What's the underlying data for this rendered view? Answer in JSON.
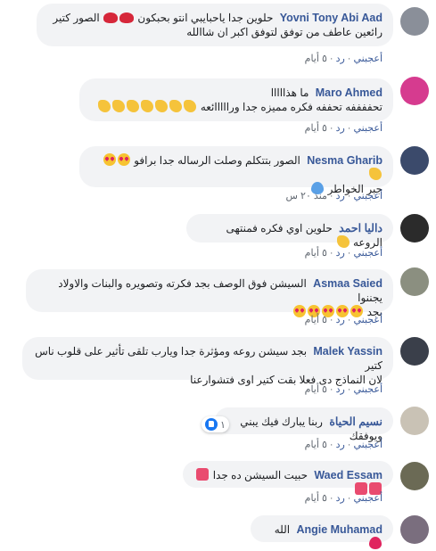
{
  "meta_labels": {
    "like": "أعجبني",
    "reply": "رد"
  },
  "comments": [
    {
      "name": "Yovni Tony Abi Aad",
      "text": "حلوين جدا ياحبايبي انتو بحبكون",
      "text2": "الصور كتير رائعين عاطف من توفق لتوفق اكبر ان شاالله",
      "time": "٥ أيام",
      "emojis": [
        "kiss",
        "kiss"
      ],
      "avatar_color": "#8a8f99"
    },
    {
      "name": "Maro Ahmed",
      "text": "ما هذااااا",
      "text2": "تحففففه تحففه فكره مميزه جدا ورااااائعه",
      "time": "٥ أيام",
      "emojis": [
        "clap",
        "clap",
        "clap",
        "clap",
        "clap",
        "clap",
        "clap",
        "clap",
        "clap"
      ],
      "avatar_color": "#d63b8f"
    },
    {
      "name": "Nesma Gharib",
      "text": "الصور بتتكلم وصلت الرساله جدا برافو",
      "text2": "جبر الخواطر",
      "time": "منذ ٢٠ س",
      "emojis": [
        "hearteyes",
        "hearteyes",
        "clap"
      ],
      "avatar_color": "#3b4a6b"
    },
    {
      "name": "داليا احمد",
      "text": "حلوين اوي فكره فمنتهى الروعه",
      "text2": "",
      "time": "٥ أيام",
      "emojis": [
        "clap"
      ],
      "avatar_color": "#2b2b2b"
    },
    {
      "name": "Asmaa Saied",
      "text": "السيشن فوق الوصف بجد فكرته وتصويره والبنات والاولاد يجننوا",
      "text2": "بجد",
      "time": "٥ أيام",
      "emojis": [
        "hearteyes",
        "hearteyes",
        "hearteyes",
        "hearteyes",
        "hearteyes"
      ],
      "avatar_color": "#8b8f80"
    },
    {
      "name": "Malek Yassin",
      "text": "بجد سيشن روعه ومؤثرة جدا ويارب تلقى تأثير على قلوب ناس كتير",
      "text2": "لان النماذج دى فعلا بقت كتير اوى فتشوارعنا",
      "time": "٥ أيام",
      "emojis": [],
      "avatar_color": "#3a3f4a"
    },
    {
      "name": "نسيم الحياة",
      "text": "ربنا يبارك فيك يبني ويوفقك",
      "text2": "",
      "time": "٥ أيام",
      "emojis": [],
      "avatar_color": "#c9c2b5",
      "reaction_count": "١"
    },
    {
      "name": "Waed Essam",
      "text": "حبيت السيشن ده جدا",
      "text2": "",
      "time": "٥ أيام",
      "emojis": [
        "heartgift",
        "heartgift",
        "heartgift"
      ],
      "avatar_color": "#6b6a55"
    },
    {
      "name": "Angie Muhamad",
      "text": "الله",
      "text2": "",
      "time": "",
      "emojis": [
        "redheart"
      ],
      "avatar_color": "#7a6e7e"
    }
  ]
}
